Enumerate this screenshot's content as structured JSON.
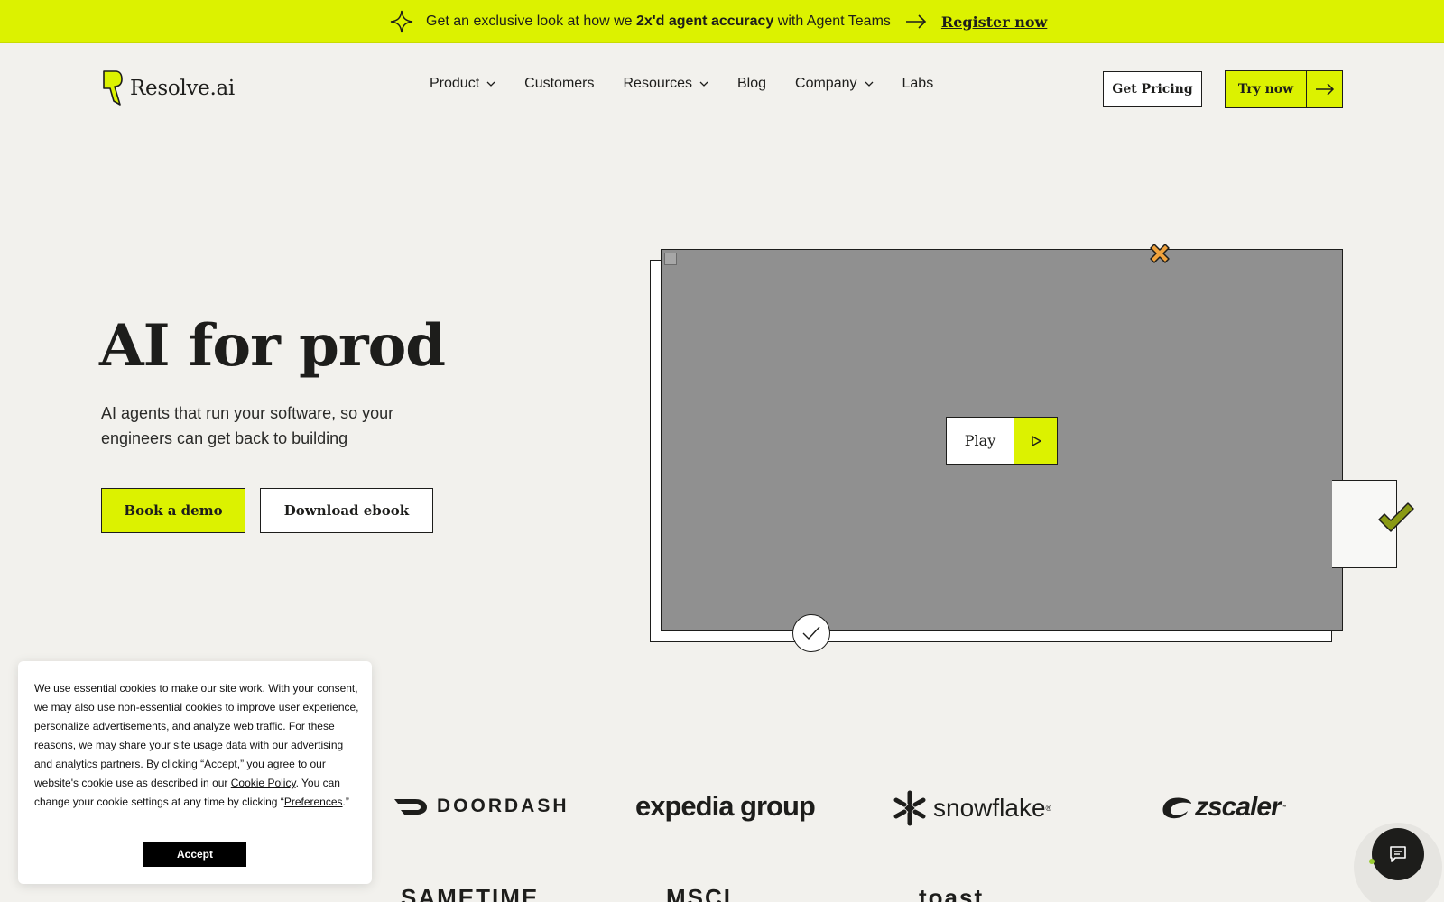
{
  "announcement": {
    "text_before": "Get an exclusive look at how we ",
    "text_bold": "2x'd agent accuracy",
    "text_after": " with Agent Teams",
    "cta": "Register now"
  },
  "brand": {
    "name": "Resolve.ai",
    "accent": "#dcf200"
  },
  "nav": {
    "items": [
      {
        "label": "Product",
        "dropdown": true
      },
      {
        "label": "Customers",
        "dropdown": false
      },
      {
        "label": "Resources",
        "dropdown": true
      },
      {
        "label": "Blog",
        "dropdown": false
      },
      {
        "label": "Company",
        "dropdown": true
      },
      {
        "label": "Labs",
        "dropdown": false
      }
    ],
    "get_pricing": "Get Pricing",
    "try_now": "Try now"
  },
  "hero": {
    "title": "AI for prod",
    "subtitle": "AI agents that run your software, so your engineers can get back to building",
    "book_demo": "Book a demo",
    "download_ebook": "Download ebook"
  },
  "video": {
    "play_label": "Play"
  },
  "logos": {
    "row1": [
      "DOORDASH",
      "expedia group",
      "snowflake",
      "zscaler"
    ],
    "row2": [
      "SAMETIME",
      "MSCI",
      "toast"
    ]
  },
  "cookie": {
    "text_1": "We use essential cookies to make our site work. With your consent, we may also use non-essential cookies to improve user experience, personalize advertisements, and analyze web traffic. For these reasons, we may share your site usage data with our advertising and analytics partners. By clicking “Accept,” you agree to our website's cookie use as described in our ",
    "link_policy": "Cookie Policy",
    "text_2": ". You can change your cookie settings at any time by clicking “",
    "link_prefs": "Preferences",
    "text_3": ".”",
    "accept": "Accept"
  }
}
